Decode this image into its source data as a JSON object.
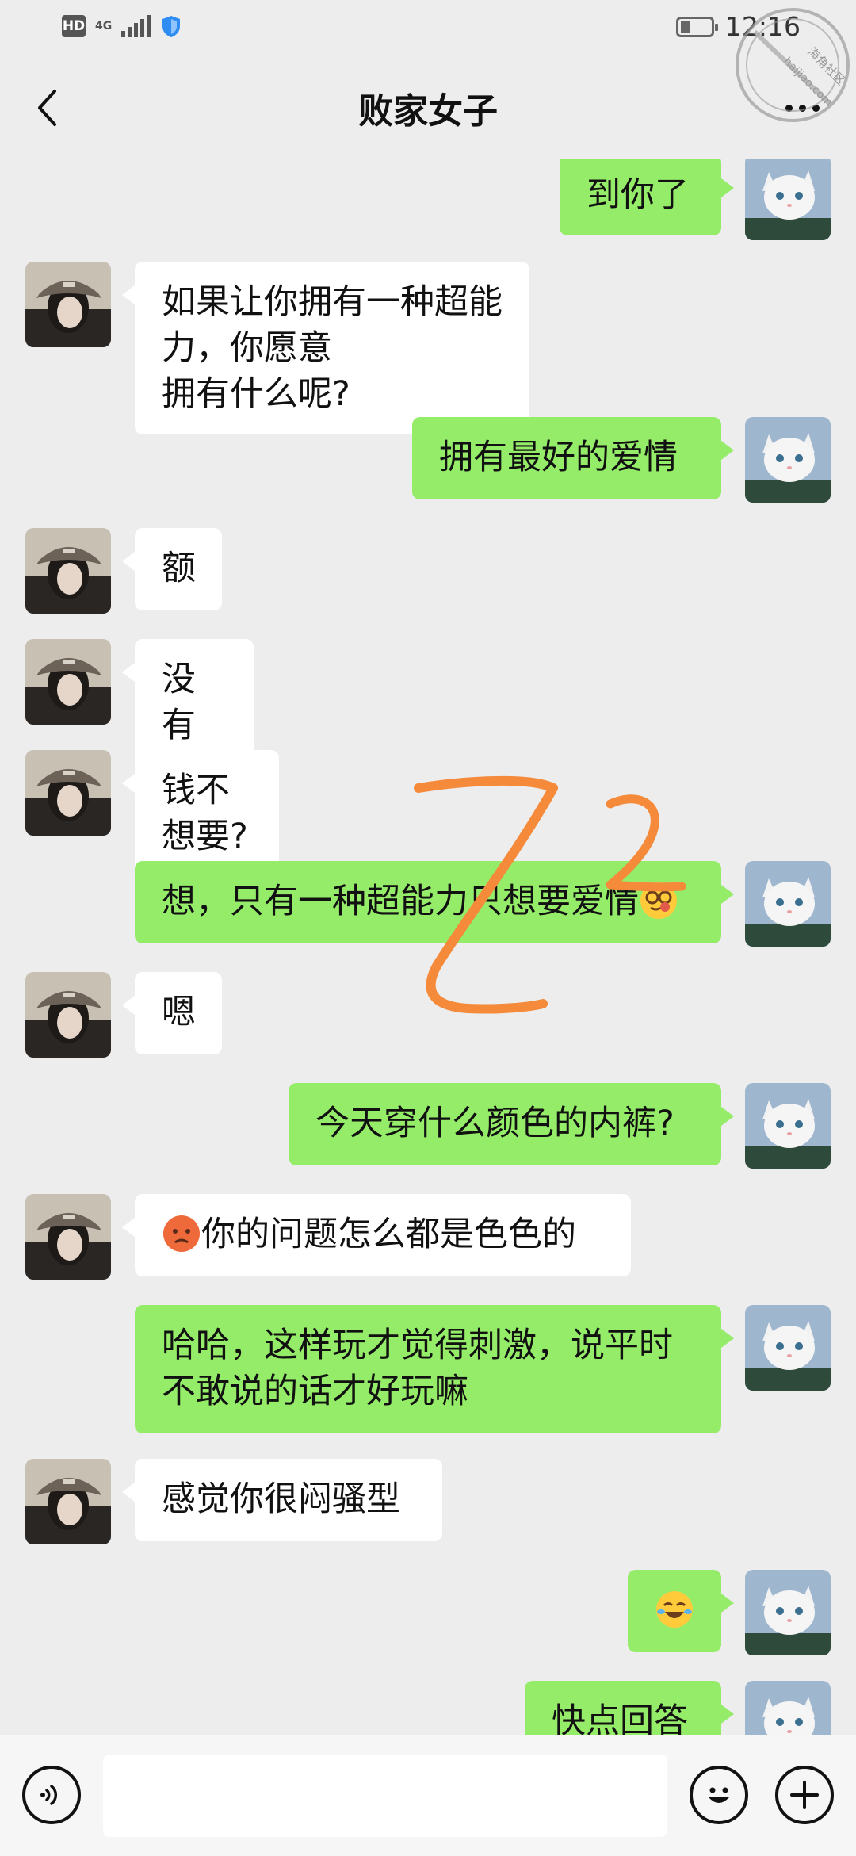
{
  "status_bar": {
    "hd": "HD",
    "network": "4G",
    "time": "12:16",
    "battery_level": 0.3
  },
  "header": {
    "title": "败家女子",
    "back_icon": "chevron-left-icon",
    "more_icon": "more-dots-icon"
  },
  "watermark": {
    "line1": "海角社区",
    "line2": "haijiao.com"
  },
  "messages": [
    {
      "side": "right",
      "text": "到你了"
    },
    {
      "side": "left",
      "text": "如果让你拥有一种超能力，你愿意\n拥有什么呢?"
    },
    {
      "side": "right",
      "text": "拥有最好的爱情"
    },
    {
      "side": "left",
      "text": "额"
    },
    {
      "side": "left",
      "text": "没有了?"
    },
    {
      "side": "left",
      "text": "钱不想要?"
    },
    {
      "side": "right",
      "text": "想，只有一种超能力只想要爱情",
      "emoji": "smirk-glasses-emoji"
    },
    {
      "side": "left",
      "text": "嗯"
    },
    {
      "side": "right",
      "text": "今天穿什么颜色的内裤?"
    },
    {
      "side": "left",
      "text": "你的问题怎么都是色色的",
      "emoji_before": "pouting-face-emoji"
    },
    {
      "side": "right",
      "text": "哈哈，这样玩才觉得刺激，说平时\n不敢说的话才好玩嘛"
    },
    {
      "side": "left",
      "text": "感觉你很闷骚型"
    },
    {
      "side": "right",
      "text": "",
      "emoji": "laughing-crying-emoji"
    },
    {
      "side": "right",
      "text": "快点回答"
    }
  ],
  "input_bar": {
    "voice_icon": "voice-icon",
    "emoji_icon": "emoji-icon",
    "add_icon": "plus-icon",
    "input_value": ""
  },
  "colors": {
    "background": "#ededed",
    "my_bubble": "#95ec69",
    "their_bubble": "#ffffff",
    "scribble": "#f58a3a"
  }
}
